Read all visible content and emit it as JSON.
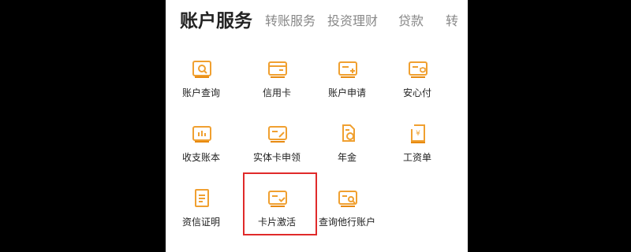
{
  "theme": {
    "accent": "#f5a623",
    "accent_dark": "#e8870a",
    "highlight": "#e02a2a"
  },
  "tabs": [
    {
      "label": "账户服务",
      "active": true
    },
    {
      "label": "转账服务",
      "active": false
    },
    {
      "label": "投资理财",
      "active": false
    },
    {
      "label": "贷款",
      "active": false
    },
    {
      "label": "转",
      "active": false
    }
  ],
  "services": [
    {
      "label": "账户查询",
      "icon": "account-query-icon"
    },
    {
      "label": "信用卡",
      "icon": "credit-card-icon"
    },
    {
      "label": "账户申请",
      "icon": "account-apply-icon"
    },
    {
      "label": "安心付",
      "icon": "secure-pay-icon"
    },
    {
      "label": "收支账本",
      "icon": "ledger-icon"
    },
    {
      "label": "实体卡申领",
      "icon": "physical-card-icon"
    },
    {
      "label": "年金",
      "icon": "annuity-icon"
    },
    {
      "label": "工资单",
      "icon": "payslip-icon"
    },
    {
      "label": "资信证明",
      "icon": "credit-certificate-icon"
    },
    {
      "label": "卡片激活",
      "icon": "card-activation-icon",
      "highlighted": true
    },
    {
      "label": "查询他行账户",
      "icon": "other-bank-query-icon"
    }
  ]
}
